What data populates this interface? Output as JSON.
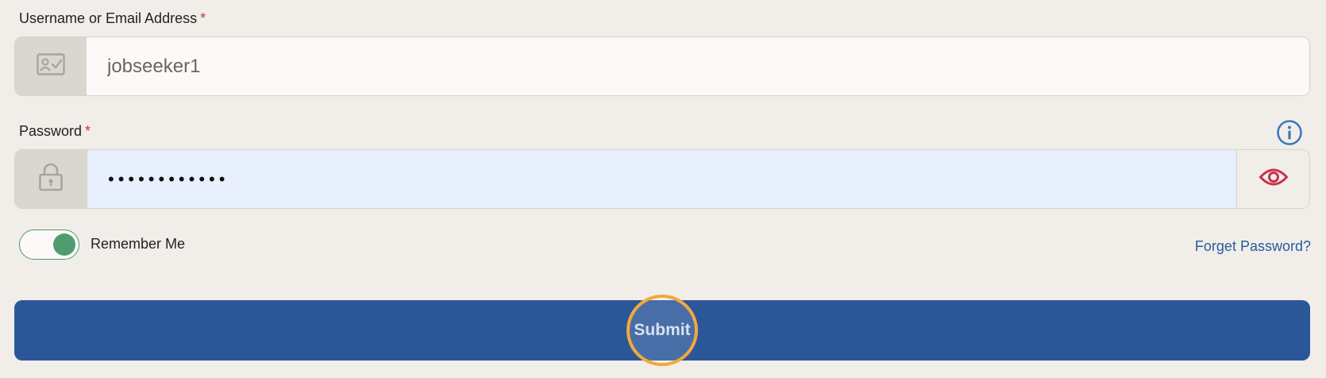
{
  "username": {
    "label": "Username or Email Address",
    "required_mark": "*",
    "value": "jobseeker1",
    "icon": "id-card-icon"
  },
  "password": {
    "label": "Password",
    "required_mark": "*",
    "value": "••••••••••••",
    "icon": "lock-icon",
    "toggle_icon": "eye-icon",
    "info_icon": "info-icon"
  },
  "remember": {
    "label": "Remember Me",
    "checked": true
  },
  "forgot_link": "Forget Password?",
  "submit_label": "Submit",
  "colors": {
    "background": "#f1eee9",
    "primary": "#2b5799",
    "toggle_on": "#4f9c6e",
    "required": "#c0392b",
    "eye": "#c8324a",
    "info": "#3b78bd",
    "focus_ring": "#f2a93b"
  }
}
